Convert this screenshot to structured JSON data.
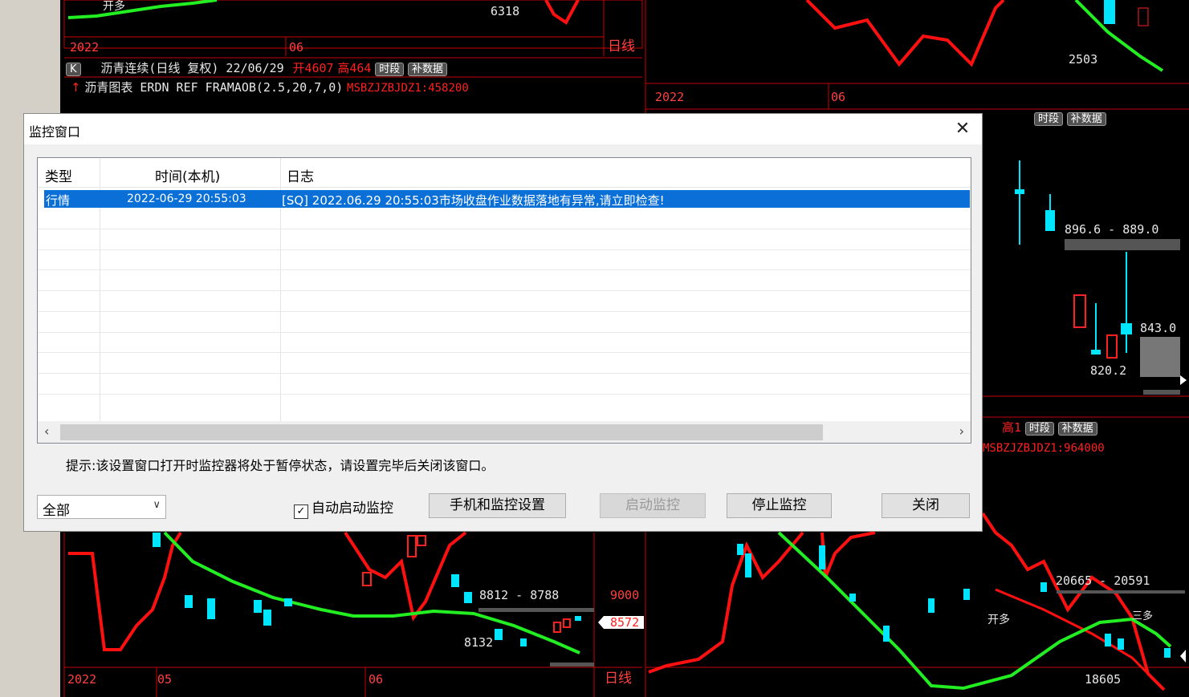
{
  "background": {
    "top_left": {
      "price_label": "6318",
      "subtitle": "开多",
      "axis_dates": [
        "2022",
        "06"
      ],
      "axis_period": "日线",
      "info_bar": {
        "name": "沥青连续(日线 复权) 22/06/29",
        "open": "开4607",
        "high": "高464",
        "btn_shiduan": "时段",
        "btn_bushuju": "补数据"
      },
      "formula_bar": {
        "title": "沥青图表 ERDN REF FRAMAOB(2.5,20,7,0)",
        "value": "MSBZJZBJDZ1:458200"
      }
    },
    "top_right": {
      "price_label": "2503",
      "axis_dates": [
        "2022",
        "06"
      ],
      "info_bar": {
        "btn_shiduan": "时段",
        "btn_bushuju": "补数据"
      },
      "price_levels": [
        "896.6 - 889.0",
        "843.0",
        "820.2"
      ]
    },
    "mid_right": {
      "info_bar": {
        "high": "高1",
        "btn_shiduan": "时段",
        "btn_bushuju": "补数据"
      },
      "formula_value": "MSBZJZBJDZ1:964000"
    },
    "bottom_left": {
      "price_range": "8812 - 8788",
      "low_label": "8132",
      "axis_ticks": [
        "9000",
        "8572"
      ],
      "axis_dates": [
        "2022",
        "05",
        "06"
      ],
      "axis_period": "日线"
    },
    "bottom_right": {
      "price_range": "20665 - 20591",
      "low_label": "18605",
      "labels": [
        "开多",
        "三多"
      ]
    }
  },
  "dialog": {
    "title": "监控窗口",
    "columns": [
      "类型",
      "时间(本机)",
      "日志"
    ],
    "rows": [
      {
        "type": "行情",
        "time": "2022-06-29 20:55:03",
        "log": "[SQ] 2022.06.29 20:55:03市场收盘作业数据落地有异常,请立即检查!"
      }
    ],
    "hint": "提示:该设置窗口打开时监控器将处于暂停状态，请设置完毕后关闭该窗口。",
    "filter_select": "全部",
    "auto_start_checkbox": {
      "label": "自动启动监控",
      "checked": true
    },
    "buttons": {
      "phone_settings": "手机和监控设置",
      "start": "启动监控",
      "stop": "停止监控",
      "close": "关闭"
    }
  }
}
